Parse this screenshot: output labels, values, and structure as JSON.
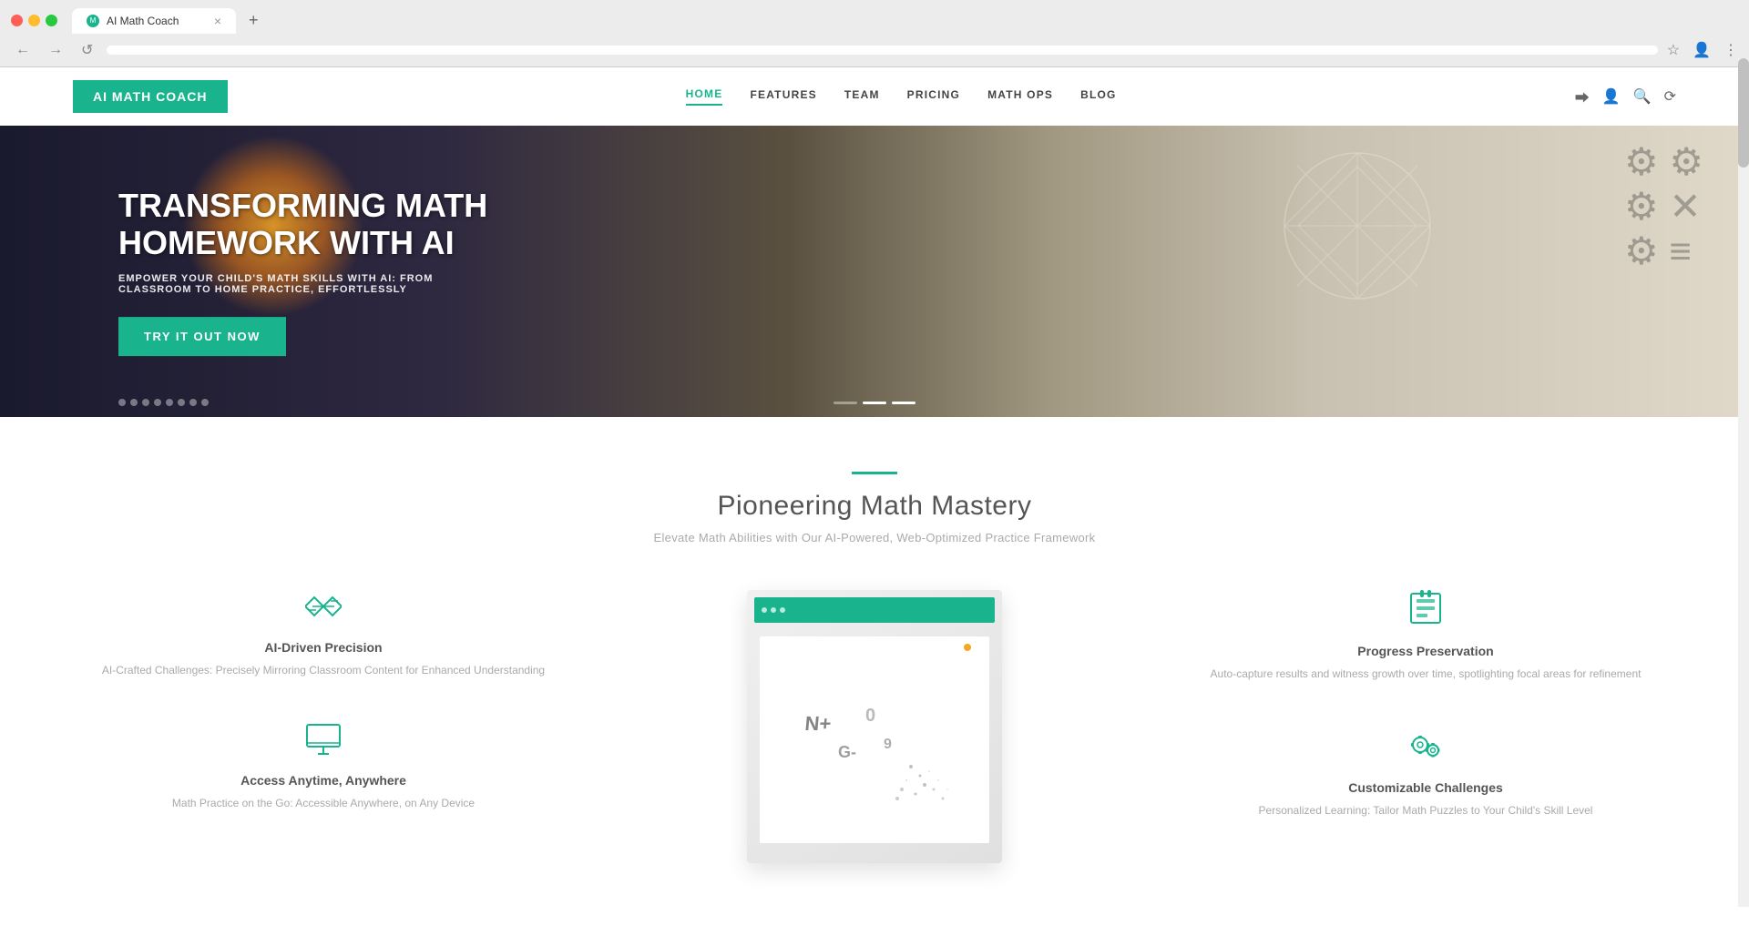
{
  "browser": {
    "tab_title": "AI Math Coach",
    "address": "",
    "nav_back": "←",
    "nav_forward": "→",
    "nav_refresh": "↺",
    "new_tab": "+"
  },
  "header": {
    "logo_label": "AI MATH COACH",
    "nav_items": [
      {
        "id": "home",
        "label": "HOME",
        "active": true
      },
      {
        "id": "features",
        "label": "FEATURES",
        "active": false
      },
      {
        "id": "team",
        "label": "TEAM",
        "active": false
      },
      {
        "id": "pricing",
        "label": "PRICING",
        "active": false
      },
      {
        "id": "mathops",
        "label": "MATH OPS",
        "active": false
      },
      {
        "id": "blog",
        "label": "BLOG",
        "active": false
      }
    ]
  },
  "hero": {
    "title": "TRANSFORMING MATH HOMEWORK WITH AI",
    "subtitle": "EMPOWER YOUR CHILD'S MATH SKILLS WITH AI: FROM CLASSROOM TO HOME PRACTICE, EFFORTLESSLY",
    "cta_label": "TRY IT OUT NOW",
    "slides": [
      {
        "active": false
      },
      {
        "active": false
      },
      {
        "active": false
      },
      {
        "active": false
      },
      {
        "active": false
      },
      {
        "active": false
      },
      {
        "active": false
      },
      {
        "active": false
      },
      {
        "active": false
      },
      {
        "active": true
      },
      {
        "active": true
      }
    ]
  },
  "features_section": {
    "accent": "#19b48e",
    "title": "Pioneering Math Mastery",
    "subtitle": "Elevate Math Abilities with Our AI-Powered, Web-Optimized Practice Framework",
    "items_left": [
      {
        "id": "ai-precision",
        "icon": "⇄",
        "title": "AI-Driven Precision",
        "desc": "AI-Crafted Challenges: Precisely Mirroring Classroom Content for Enhanced Understanding"
      },
      {
        "id": "access-anywhere",
        "icon": "🖥",
        "title": "Access Anytime, Anywhere",
        "desc": "Math Practice on the Go: Accessible Anywhere, on Any Device"
      }
    ],
    "items_right": [
      {
        "id": "progress",
        "icon": "💾",
        "title": "Progress Preservation",
        "desc": "Auto-capture results and witness growth over time, spotlighting focal areas for refinement"
      },
      {
        "id": "customizable",
        "icon": "⚙",
        "title": "Customizable Challenges",
        "desc": "Personalized Learning: Tailor Math Puzzles to Your Child's Skill Level"
      }
    ]
  }
}
